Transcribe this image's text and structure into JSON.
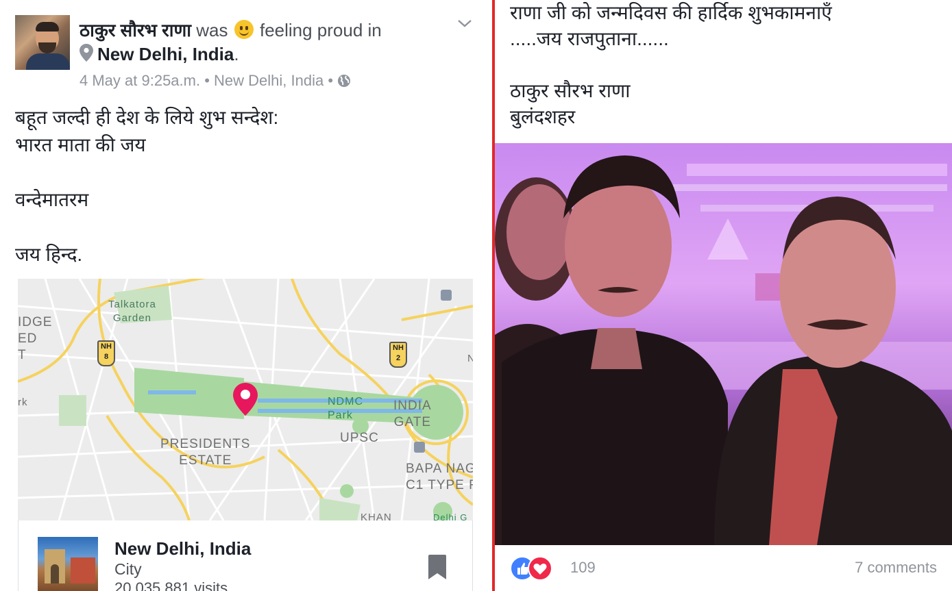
{
  "post": {
    "author": "ठाकुर सौरभ राणा",
    "was": "was",
    "feeling": "feeling proud in",
    "place": "New Delhi, India",
    "place_period": ".",
    "date": "4 May at 9:25a.m.",
    "sep": "•",
    "location": "New Delhi, India",
    "text": "बहूत जल्दी ही देश के लिये शुभ सन्देश:\nभारत माता की जय\n\nवन्देमातरम\n\nजय हिन्द."
  },
  "map": {
    "labels": {
      "talkatora": "Talkatora\nGarden",
      "idge": "IDGE\nED\nT",
      "rk": "rk",
      "nh8_top": "NH",
      "nh8_num": "8",
      "nh2_top": "NH",
      "nh2_num": "2",
      "ndmc": "NDMC\nPark",
      "india_gate": "INDIA\nGATE",
      "presidents_estate": "PRESIDENTS\nESTATE",
      "upsc": "UPSC",
      "bapa": "BAPA NAG\nC1 TYPE F",
      "khan": "KHAN",
      "delhi_g": "Delhi G",
      "n_edge": "N"
    },
    "colors": {
      "pin": "#e8175d",
      "park": "#a8d8a0",
      "road": "#f6d25e",
      "water": "#7fb7e8"
    }
  },
  "card": {
    "title": "New Delhi, India",
    "subtitle": "City",
    "visits": "20,035,881 visits"
  },
  "right": {
    "text": "राणा जी को जन्मदिवस की हार्दिक शुभकामनाएँ\n.....जय राजपुताना......\n\nठाकुर सौरभ राणा\nबुलंदशहर",
    "reactions_count": "109",
    "comments": "7 comments"
  },
  "icons": [
    "location-pin-icon",
    "smile-emoji-icon",
    "chevron-down-icon",
    "globe-icon",
    "map-pin-icon",
    "bookmark-icon",
    "like-reaction-icon",
    "love-reaction-icon"
  ]
}
